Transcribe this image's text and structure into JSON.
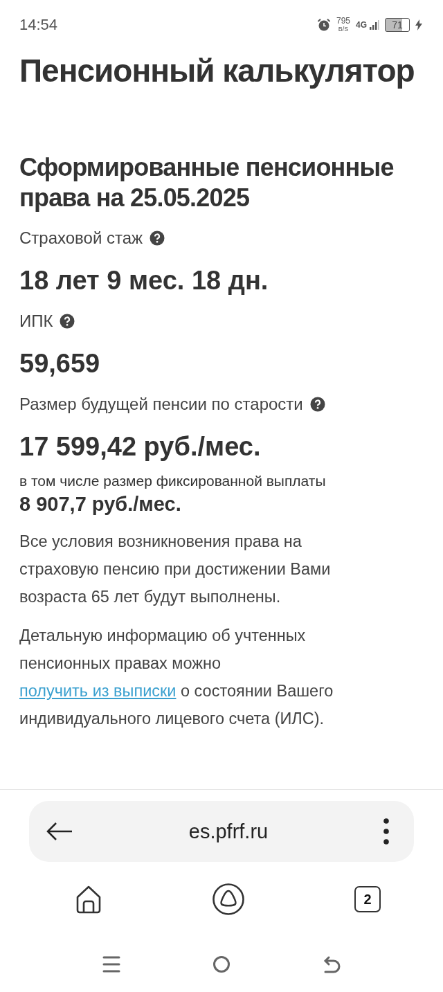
{
  "status_bar": {
    "time": "14:54",
    "speed_value": "795",
    "speed_unit": "B/S",
    "network": "4G",
    "battery": "71"
  },
  "page": {
    "title": "Пенсионный калькулятор",
    "section_title": "Сформированные пенсионные права на 25.05.2025",
    "fields": [
      {
        "label": "Страховой стаж",
        "help": true,
        "value": "18 лет 9 мес. 18 дн."
      },
      {
        "label": "ИПК",
        "help": true,
        "value": "59,659"
      },
      {
        "label": "Размер будущей пенсии по старости",
        "help": true,
        "value": "17 599,42 руб./мес.",
        "sub_label": "в том числе размер фиксированной выплаты",
        "sub_value": "8 907,7 руб./мес."
      }
    ],
    "paragraphs": [
      {
        "parts": [
          {
            "kind": "text",
            "text": "Все условия возникновения права на страховую пенсию при достижении Вами возраста 65 лет будут выполнены."
          }
        ]
      },
      {
        "parts": [
          {
            "kind": "text",
            "text": "Детальную информацию об учтенных пенсионных правах можно "
          },
          {
            "kind": "link",
            "text": "получить из выписки"
          },
          {
            "kind": "text",
            "text": " о состоянии Вашего индивидуального лицевого счета (ИЛС)."
          }
        ]
      }
    ]
  },
  "browser": {
    "url": "es.pfrf.ru",
    "tab_count": "2"
  }
}
